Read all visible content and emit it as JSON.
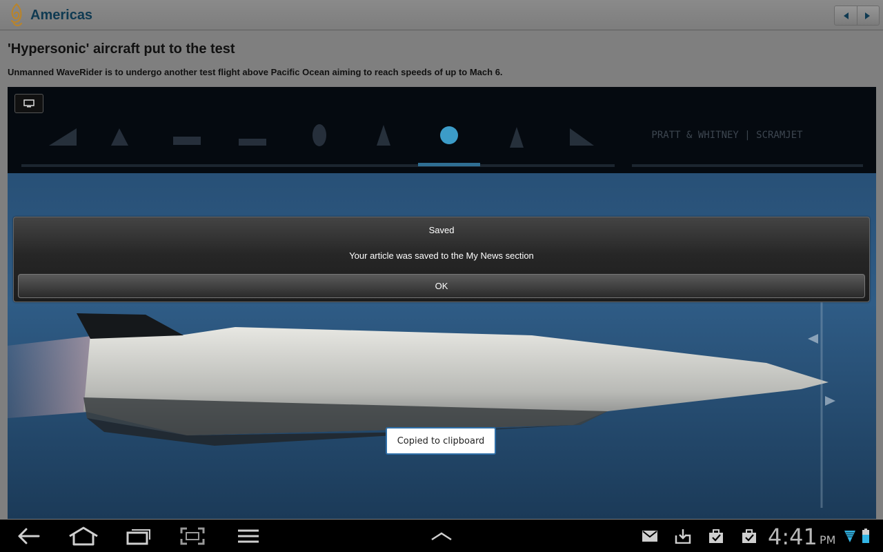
{
  "header": {
    "section_title": "Americas",
    "icons": {
      "logo": "al-jazeera-logo",
      "prev": "triangle-left-icon",
      "next": "triangle-right-icon"
    }
  },
  "article": {
    "headline": "'Hypersonic' aircraft put to the test",
    "summary": "Unmanned WaveRider is to undergo another test flight above Pacific Ocean aiming to reach speeds of up to Mach 6.",
    "video": {
      "overlay_text": "PRATT & WHITNEY | SCRAMJET",
      "fullscreen_icon": "monitor-icon"
    }
  },
  "dialog": {
    "title": "Saved",
    "message": "Your article was saved to the My News section",
    "ok_label": "OK"
  },
  "toast": {
    "text": "Copied to clipboard"
  },
  "system_bar": {
    "time": "4:41",
    "ampm": "PM",
    "nav_icons": [
      "back-icon",
      "home-icon",
      "recent-apps-icon",
      "screenshot-icon",
      "menu-icon"
    ],
    "center_icon": "chevron-up-icon",
    "notification_icons": [
      "gmail-icon",
      "download-icon",
      "task-done-icon",
      "task-done-icon"
    ],
    "status_icons": [
      "wifi-icon",
      "battery-icon"
    ],
    "colors": {
      "wifi": "#33b5e5",
      "battery": "#33b5e5"
    }
  }
}
